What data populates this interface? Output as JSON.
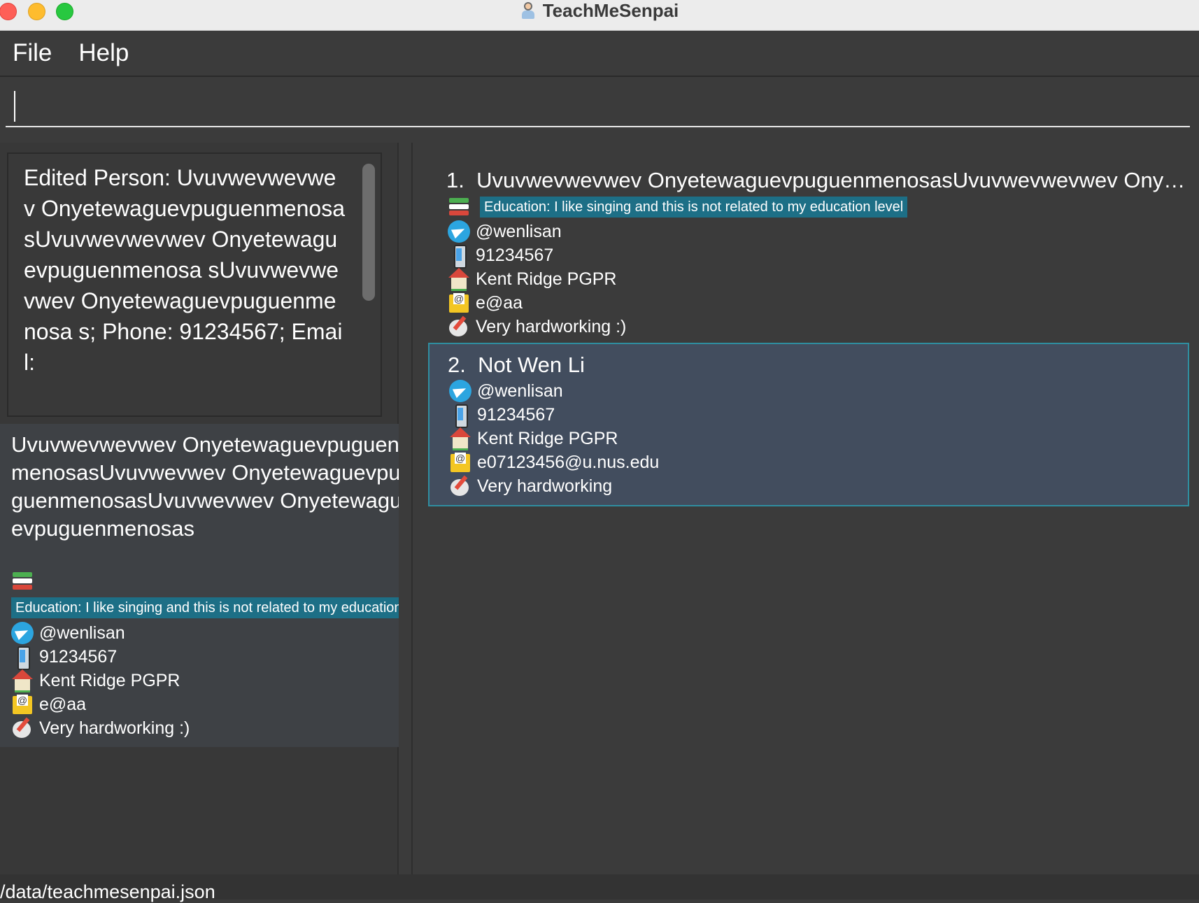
{
  "window": {
    "title": "TeachMeSenpai"
  },
  "menu": {
    "file": "File",
    "help": "Help"
  },
  "command_box": {
    "value": ""
  },
  "result_display": {
    "text": "Edited Person: Uvuvwevwevwev Onyetewaguevpuguenmenosa sUvuvwevwevwev Onyetewaguevpuguenmenosa sUvuvwevwevwev Onyetewaguevpuguenmenosa s; Phone: 91234567; Email:"
  },
  "detail": {
    "name": "Uvuvwevwevwev OnyetewaguevpuguenmenosasUvuvwevwev OnyetewaguevpuguenmenosasUvuvwevwev Onyetewaguevpuguenmenosas",
    "education": "Education: I like singing and this is not related to my education level",
    "telegram": "@wenlisan",
    "phone": "91234567",
    "address": "Kent Ridge PGPR",
    "email": "e@aa",
    "remark": "Very hardworking :)"
  },
  "persons": [
    {
      "index": "1.",
      "name": "Uvuvwevwevwev OnyetewaguevpuguenmenosasUvuvwevwevwev Onyetewaguevpuguenmenosas",
      "education": "Education: I like singing and this is not related to my education level",
      "telegram": "@wenlisan",
      "phone": "91234567",
      "address": "Kent Ridge PGPR",
      "email": "e@aa",
      "remark": "Very hardworking :)"
    },
    {
      "index": "2.",
      "name": "Not Wen Li",
      "telegram": "@wenlisan",
      "phone": "91234567",
      "address": "Kent Ridge PGPR",
      "email": "e07123456@u.nus.edu",
      "remark": "Very hardworking"
    }
  ],
  "status_bar": {
    "path": "/data/teachmesenpai.json"
  },
  "colors": {
    "accent_tag": "#1d6f86",
    "selected_card": "#424d5e",
    "selected_border": "#2f8ea0"
  }
}
